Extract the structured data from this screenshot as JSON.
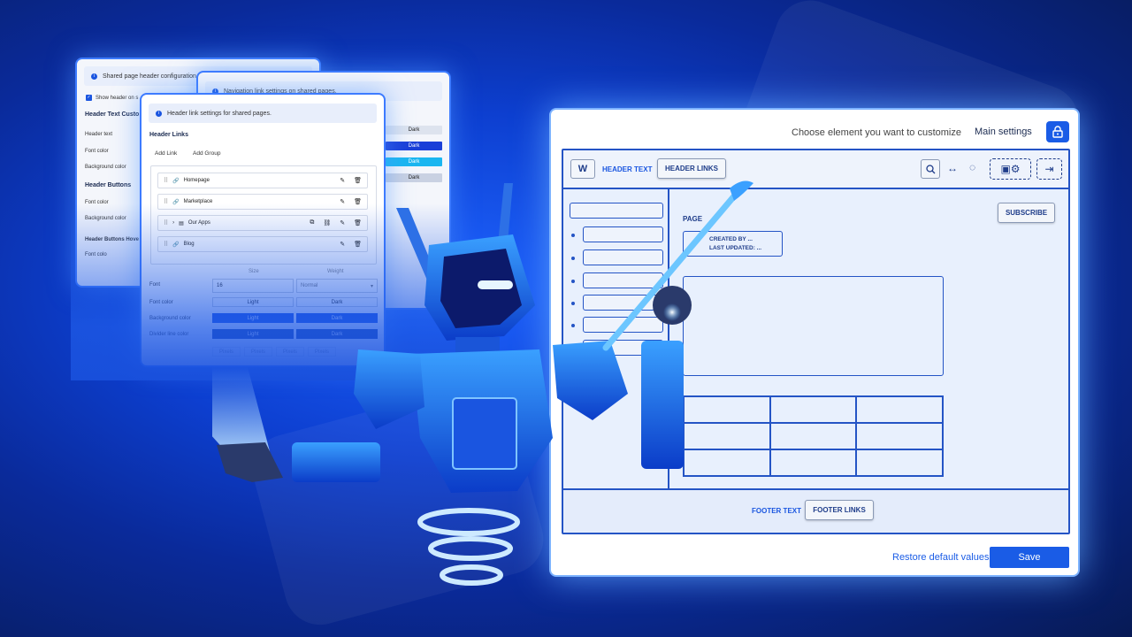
{
  "back_card_1": {
    "info": "Shared page header configuration.",
    "checkbox_label": "Show header on s",
    "section_text": "Header Text Custo",
    "header_text": "Header text",
    "font_color": "Font color",
    "background_color": "Background color",
    "section_buttons": "Header Buttons",
    "font_color_2": "Font color",
    "background_color_2": "Background color",
    "section_buttons_hover": "Header Buttons Hove",
    "font_color_3": "Font colo"
  },
  "back_card_2": {
    "info": "Navigation link settings on shared pages.",
    "pills": [
      "Dark",
      "Dark",
      "Dark",
      "Dark"
    ]
  },
  "front_card": {
    "info": "Header link settings for shared pages.",
    "title": "Header Links",
    "add_link": "Add Link",
    "add_group": "Add Group",
    "links": [
      "Homepage",
      "Marketplace",
      "Our Apps",
      "Blog"
    ],
    "size_header": "Size",
    "weight_header": "Weight",
    "font_label": "Font",
    "font_size": "16",
    "font_weight": "Normal",
    "font_color_label": "Font color",
    "background_color_label": "Background color",
    "divider_color_label": "Divider line color",
    "light": "Light",
    "dark": "Dark",
    "pixels": [
      "Pixels",
      "Pixels",
      "Pixels",
      "Pixels"
    ]
  },
  "panel": {
    "prompt": "Choose element you want to customize",
    "main_settings": "Main settings",
    "header_text": "HEADER TEXT",
    "header_links": "HEADER LINKS",
    "page": "PAGE",
    "created_by": "CREATED BY ...",
    "last_updated": "LAST UPDATED: ...",
    "subscribe": "SUBSCRIBE",
    "footer_text": "FOOTER TEXT",
    "footer_links": "FOOTER LINKS",
    "restore": "Restore default values",
    "save": "Save",
    "logo_letter": "W"
  },
  "colors": {
    "accent": "#1a5ce6",
    "outline": "#2454c5",
    "background": "#0d3fd0"
  }
}
